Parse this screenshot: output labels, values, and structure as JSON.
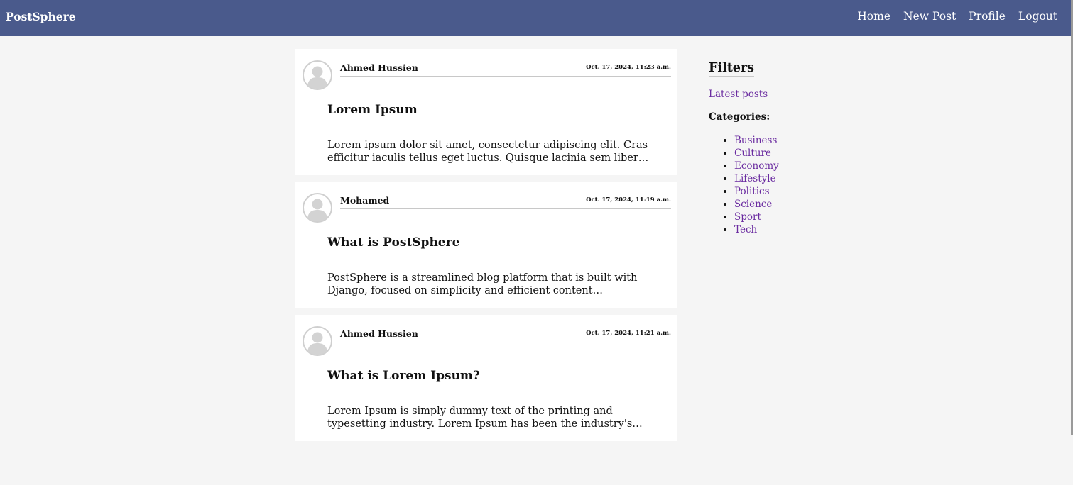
{
  "navbar": {
    "brand": "PostSphere",
    "links": [
      "Home",
      "New Post",
      "Profile",
      "Logout"
    ]
  },
  "posts": [
    {
      "author": "Ahmed Hussien",
      "date": "Oct. 17, 2024, 11:23 a.m.",
      "title": "Lorem Ipsum",
      "excerpt": "Lorem ipsum dolor sit amet, consectetur adipiscing elit. Cras efficitur iaculis tellus eget luctus. Quisque lacinia sem liber…"
    },
    {
      "author": "Mohamed",
      "date": "Oct. 17, 2024, 11:19 a.m.",
      "title": "What is PostSphere",
      "excerpt": "PostSphere is a streamlined blog platform that is built with Django, focused on simplicity and efficient content…"
    },
    {
      "author": "Ahmed Hussien",
      "date": "Oct. 17, 2024, 11:21 a.m.",
      "title": "What is Lorem Ipsum?",
      "excerpt": "Lorem Ipsum is simply dummy text of the printing and typesetting industry. Lorem Ipsum has been the industry's…"
    }
  ],
  "sidebar": {
    "title": "Filters",
    "latest": "Latest posts",
    "categories_title": "Categories:",
    "categories": [
      "Business",
      "Culture",
      "Economy",
      "Lifestyle",
      "Politics",
      "Science",
      "Sport",
      "Tech"
    ]
  },
  "colors": {
    "navbar": "#4a5a8c",
    "link": "#6a2ba0",
    "background": "#f5f5f5"
  },
  "icons": {
    "avatar": "user-avatar-icon"
  }
}
